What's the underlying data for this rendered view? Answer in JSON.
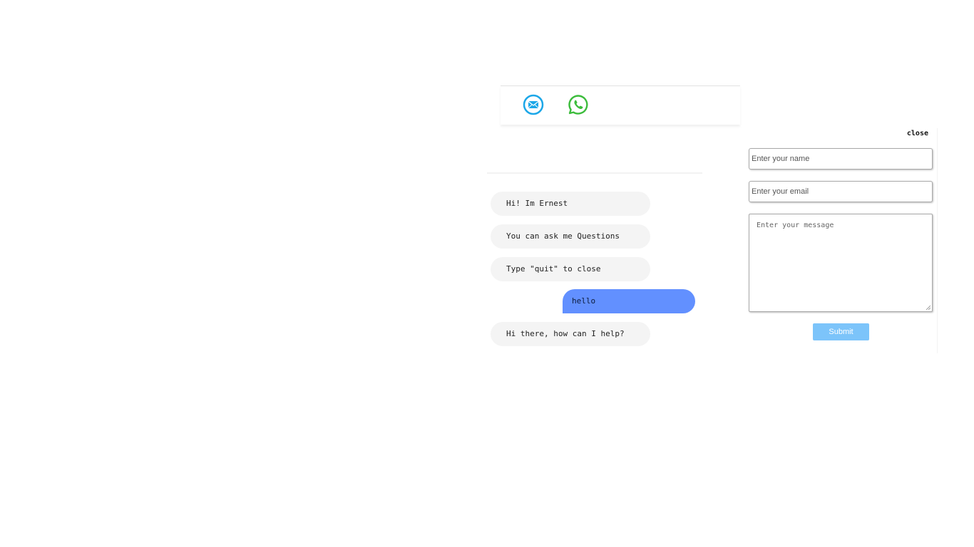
{
  "contact_icons": {
    "email": {
      "icon": "email-icon",
      "color": "#1ca7e8"
    },
    "whatsapp": {
      "icon": "whatsapp-icon",
      "color": "#3cbc3c"
    }
  },
  "chat": {
    "messages": [
      {
        "from": "bot",
        "text": "Hi! Im Ernest"
      },
      {
        "from": "bot",
        "text": "You can ask me Questions"
      },
      {
        "from": "bot",
        "text": "Type \"quit\" to close"
      },
      {
        "from": "user",
        "text": "hello"
      },
      {
        "from": "bot",
        "text": "Hi there, how can I help?"
      }
    ],
    "user_bubble_color": "#6290ff",
    "bot_bubble_color": "#f4f4f4"
  },
  "contact_form": {
    "close_label": "close",
    "name_placeholder": "Enter your name",
    "email_placeholder": "Enter your email",
    "message_placeholder": "Enter your message",
    "submit_label": "Submit",
    "submit_color": "#7cc4fa"
  }
}
